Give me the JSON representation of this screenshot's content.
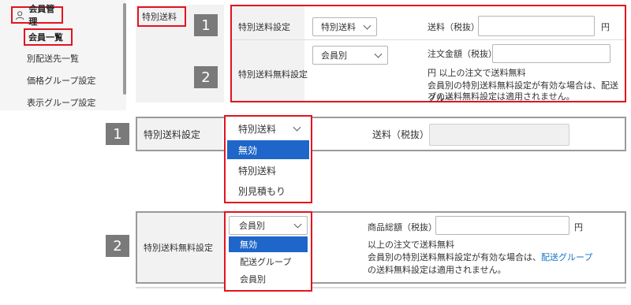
{
  "sidebar": {
    "title": "会員管理",
    "items": [
      {
        "label": "会員一覧"
      },
      {
        "label": "別配送先一覧"
      },
      {
        "label": "価格グループ設定"
      },
      {
        "label": "表示グループ設定"
      }
    ]
  },
  "top": {
    "tab_label": "特別送料",
    "badge1": "1",
    "badge2": "2",
    "row1": {
      "label": "特別送料設定",
      "select_value": "特別送料",
      "fee_label": "送料（税抜）:",
      "unit": "円"
    },
    "row2": {
      "label": "特別送料無料設定",
      "select_value": "会員別",
      "amount_label": "注文金額（税抜）:",
      "note1": "円 以上の注文で送料無料",
      "note2": "会員別の特別送料無料設定が有効な場合は、配送グルー",
      "note3": "プの送料無料設定は適用されません。"
    }
  },
  "bottom1": {
    "badge": "1",
    "label": "特別送料設定",
    "select_value": "特別送料",
    "fee_label": "送料（税抜）:",
    "options": [
      "無効",
      "特別送料",
      "別見積もり"
    ]
  },
  "bottom2": {
    "badge": "2",
    "label": "特別送料無料設定",
    "select_value": "会員別",
    "amount_label": "商品総額（税抜）:",
    "unit": "円",
    "note1": "以上の注文で送料無料",
    "note2_pre": "会員別の特別送料無料設定が有効な場合は、",
    "note2_link": "配送グループ",
    "note3": "の送料無料設定は適用されません。",
    "options": [
      "無効",
      "配送グループ",
      "会員別"
    ]
  },
  "colors": {
    "highlight": "#e2141e",
    "selected_option": "#1e66c9",
    "badge": "#7a7a7a",
    "link": "#1a73c8"
  }
}
